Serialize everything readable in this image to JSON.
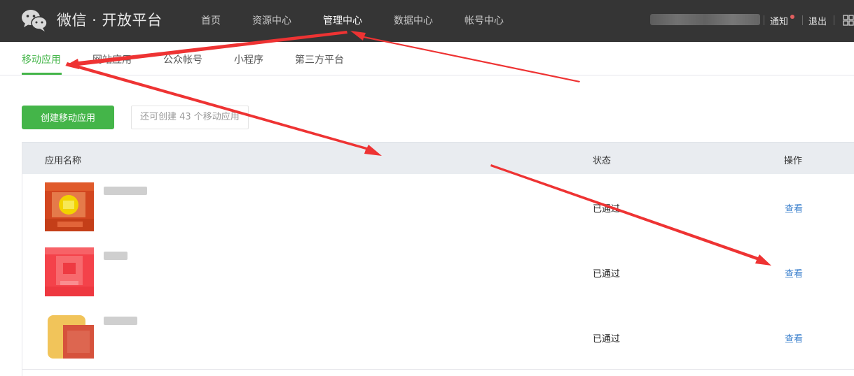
{
  "header": {
    "brand": "微信 · 开放平台",
    "nav": [
      {
        "label": "首页",
        "active": false
      },
      {
        "label": "资源中心",
        "active": false
      },
      {
        "label": "管理中心",
        "active": true
      },
      {
        "label": "数据中心",
        "active": false
      },
      {
        "label": "帐号中心",
        "active": false
      }
    ],
    "notify_label": "通知",
    "logout_label": "退出"
  },
  "subnav": {
    "items": [
      {
        "label": "移动应用",
        "active": true
      },
      {
        "label": "网站应用",
        "active": false
      },
      {
        "label": "公众帐号",
        "active": false
      },
      {
        "label": "小程序",
        "active": false
      },
      {
        "label": "第三方平台",
        "active": false
      }
    ]
  },
  "actions": {
    "create_label": "创建移动应用",
    "quota_text": "还可创建 43 个移动应用"
  },
  "table": {
    "headers": [
      "应用名称",
      "状态",
      "操作"
    ],
    "rows": [
      {
        "status": "已通过",
        "action": "查看"
      },
      {
        "status": "已通过",
        "action": "查看"
      },
      {
        "status": "已通过",
        "action": "查看"
      }
    ]
  },
  "colors": {
    "accent": "#44b549",
    "topbar": "#353535",
    "link": "#3a7fcc",
    "arrow": "#ee3333"
  }
}
